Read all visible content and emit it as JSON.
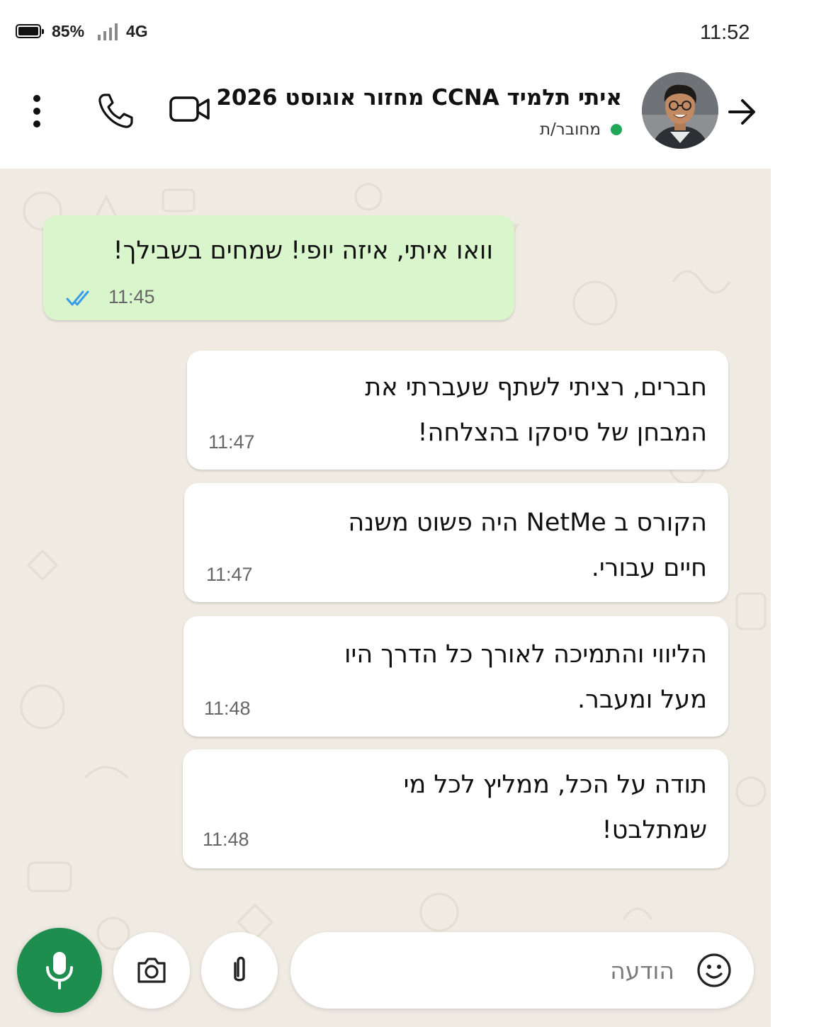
{
  "status_bar": {
    "battery_percent": "85%",
    "network": "4G",
    "time": "11:52"
  },
  "header": {
    "contact_name": "איתי תלמיד CCNA מחזור אוגוסט 2026",
    "status": "מחובר/ת",
    "status_color": "#1fa855",
    "icons": [
      "back-arrow-icon",
      "avatar",
      "video-call-icon",
      "voice-call-icon",
      "more-options-icon"
    ]
  },
  "messages": [
    {
      "direction": "outgoing",
      "text": "וואו איתי, איזה יופי! שמחים בשבילך!",
      "time": "11:45",
      "read": true
    },
    {
      "direction": "incoming",
      "lines": [
        "חברים, רציתי לשתף שעברתי את",
        "המבחן של סיסקו בהצלחה!"
      ],
      "time": "11:47"
    },
    {
      "direction": "incoming",
      "lines": [
        "הקורס ב NetMe היה פשוט משנה",
        "חיים עבורי."
      ],
      "time": "11:47"
    },
    {
      "direction": "incoming",
      "lines": [
        "הליווי והתמיכה לאורך כל הדרך היו",
        "מעל ומעבר."
      ],
      "time": "11:48"
    },
    {
      "direction": "incoming",
      "lines": [
        "תודה על הכל, ממליץ לכל מי",
        "שמתלבט!"
      ],
      "time": "11:48"
    }
  ],
  "composer": {
    "placeholder": "הודעה",
    "value": "",
    "buttons": [
      "emoji-icon",
      "attach-icon",
      "camera-icon",
      "microphone-icon"
    ]
  },
  "colors": {
    "outgoing_bubble": "#d9f5cc",
    "incoming_bubble": "#ffffff",
    "chat_background": "#efeae2",
    "mic_button": "#1e8e4e",
    "read_ticks": "#3a9be8"
  }
}
